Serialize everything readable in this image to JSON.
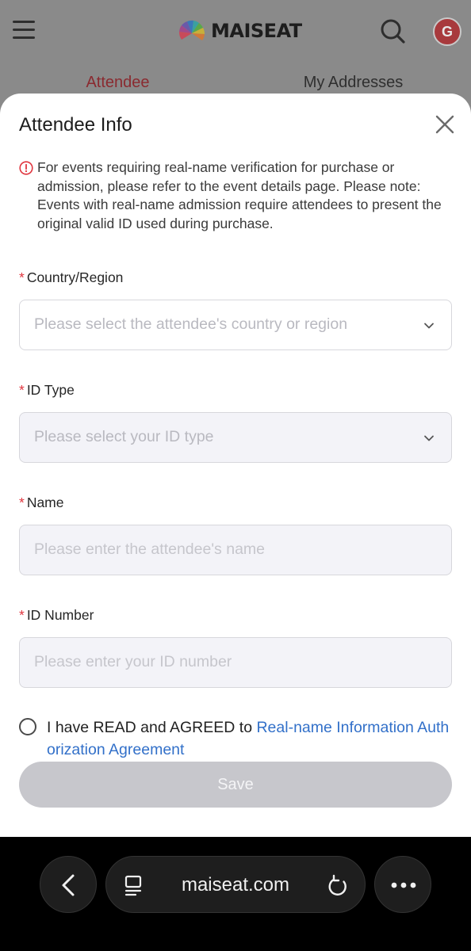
{
  "header": {
    "brand": "MAISEAT",
    "avatar_letter": "G",
    "tabs": [
      {
        "label": "Attendee",
        "active": true
      },
      {
        "label": "My Addresses",
        "active": false
      }
    ]
  },
  "modal": {
    "title": "Attendee Info",
    "notice": "For events requiring real-name verification for purchase or admission, please refer to the event details page. Please note: Events with real-name admission require attendees to present the original valid ID used during purchase.",
    "fields": [
      {
        "label": "Country/Region",
        "placeholder": "Please select the attendee's country or region",
        "type": "select"
      },
      {
        "label": "ID Type",
        "placeholder": "Please select your ID type",
        "type": "select"
      },
      {
        "label": "Name",
        "placeholder": "Please enter the attendee's name",
        "type": "text"
      },
      {
        "label": "ID Number",
        "placeholder": "Please enter your ID number",
        "type": "text"
      }
    ],
    "agreement_prefix": "I have READ and AGREED to ",
    "agreement_link": "Real-name Information Authorization Agreement",
    "save_label": "Save"
  },
  "browser": {
    "url": "maiseat.com"
  },
  "colors": {
    "accent_red": "#e0353e",
    "link_blue": "#3270c9",
    "disabled_button": "#c7c7cc"
  }
}
